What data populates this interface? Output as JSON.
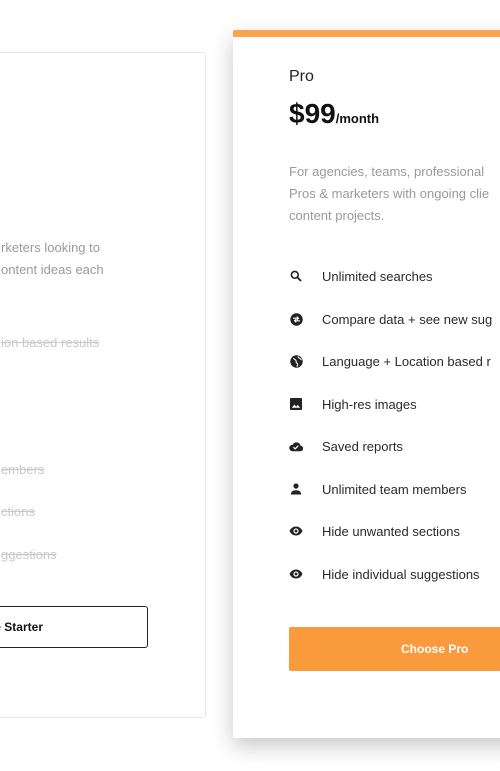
{
  "starter": {
    "description_lines": [
      "rketers looking to",
      "ontent ideas each"
    ],
    "features": [
      "ion based results",
      "embers",
      "ctions",
      "ggestions"
    ],
    "button_label": "e Starter"
  },
  "pro": {
    "name": "Pro",
    "price": "$99",
    "period": "/month",
    "description_lines": [
      "For agencies, teams, professional",
      "Pros & marketers with ongoing clie",
      "content projects."
    ],
    "features": [
      {
        "icon": "search-icon",
        "label": "Unlimited searches"
      },
      {
        "icon": "compare-icon",
        "label": "Compare data + see new sug"
      },
      {
        "icon": "globe-icon",
        "label": "Language + Location based r"
      },
      {
        "icon": "image-icon",
        "label": "High-res images"
      },
      {
        "icon": "cloud-check-icon",
        "label": "Saved reports"
      },
      {
        "icon": "person-icon",
        "label": "Unlimited team members"
      },
      {
        "icon": "eye-icon",
        "label": "Hide unwanted sections"
      },
      {
        "icon": "eye-icon",
        "label": "Hide individual suggestions"
      }
    ],
    "button_label": "Choose Pro",
    "accent_color": "#f9a54a"
  }
}
